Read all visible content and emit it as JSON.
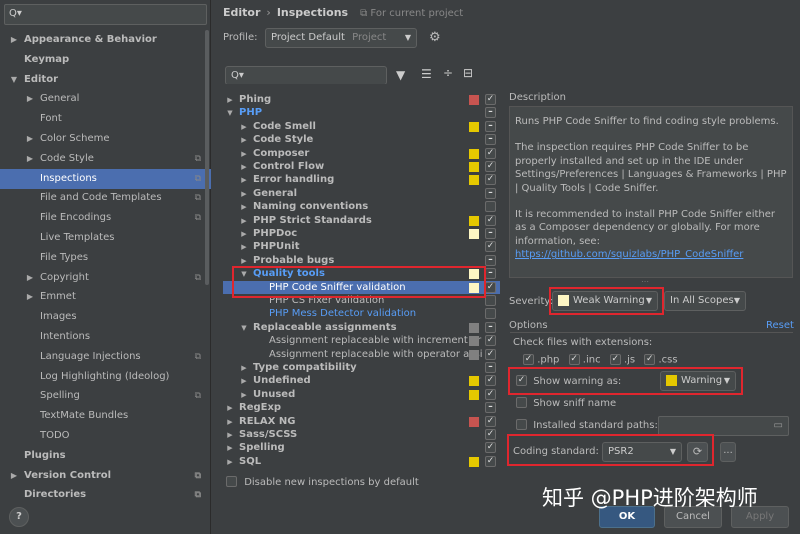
{
  "sidebar": {
    "search_placeholder": "Q▾",
    "items": [
      {
        "label": "Appearance & Behavior",
        "bold": true,
        "arrow": "▶",
        "indent": 0
      },
      {
        "label": "Keymap",
        "bold": true,
        "arrow": "",
        "indent": 0
      },
      {
        "label": "Editor",
        "bold": true,
        "arrow": "▼",
        "indent": 0
      },
      {
        "label": "General",
        "arrow": "▶",
        "indent": 1
      },
      {
        "label": "Font",
        "arrow": "",
        "indent": 1
      },
      {
        "label": "Color Scheme",
        "arrow": "▶",
        "indent": 1
      },
      {
        "label": "Code Style",
        "arrow": "▶",
        "indent": 1,
        "copy": true
      },
      {
        "label": "Inspections",
        "arrow": "",
        "indent": 1,
        "copy": true,
        "selected": true
      },
      {
        "label": "File and Code Templates",
        "arrow": "",
        "indent": 1,
        "copy": true
      },
      {
        "label": "File Encodings",
        "arrow": "",
        "indent": 1,
        "copy": true
      },
      {
        "label": "Live Templates",
        "arrow": "",
        "indent": 1
      },
      {
        "label": "File Types",
        "arrow": "",
        "indent": 1
      },
      {
        "label": "Copyright",
        "arrow": "▶",
        "indent": 1,
        "copy": true
      },
      {
        "label": "Emmet",
        "arrow": "▶",
        "indent": 1
      },
      {
        "label": "Images",
        "arrow": "",
        "indent": 1
      },
      {
        "label": "Intentions",
        "arrow": "",
        "indent": 1
      },
      {
        "label": "Language Injections",
        "arrow": "",
        "indent": 1,
        "copy": true
      },
      {
        "label": "Log Highlighting (Ideolog)",
        "arrow": "",
        "indent": 1
      },
      {
        "label": "Spelling",
        "arrow": "",
        "indent": 1,
        "copy": true
      },
      {
        "label": "TextMate Bundles",
        "arrow": "",
        "indent": 1
      },
      {
        "label": "TODO",
        "arrow": "",
        "indent": 1
      },
      {
        "label": "Plugins",
        "bold": true,
        "arrow": "",
        "indent": 0
      },
      {
        "label": "Version Control",
        "bold": true,
        "arrow": "▶",
        "indent": 0,
        "copy": true
      },
      {
        "label": "Directories",
        "bold": true,
        "arrow": "",
        "indent": 0,
        "copy": true
      }
    ]
  },
  "header": {
    "crumb1": "Editor",
    "sep": "›",
    "crumb2": "Inspections",
    "scope_note": "⧉ For current project"
  },
  "profile": {
    "label": "Profile:",
    "value": "Project Default",
    "value_hint": "Project"
  },
  "toolbar": {
    "search_placeholder": "Q▾"
  },
  "tree": [
    {
      "label": "Phing",
      "level": 0,
      "arrow": "▶",
      "bold": true,
      "sev": "#c75450",
      "cb": "✓"
    },
    {
      "label": "PHP",
      "level": 0,
      "arrow": "▼",
      "bold": true,
      "blue": true,
      "sev": "",
      "cb": "–"
    },
    {
      "label": "Code Smell",
      "level": 1,
      "arrow": "▶",
      "bold": true,
      "sev": "#e5c800",
      "cb": "–"
    },
    {
      "label": "Code Style",
      "level": 1,
      "arrow": "▶",
      "bold": true,
      "sev": "",
      "cb": "–"
    },
    {
      "label": "Composer",
      "level": 1,
      "arrow": "▶",
      "bold": true,
      "sev": "#e5c800",
      "cb": "✓"
    },
    {
      "label": "Control Flow",
      "level": 1,
      "arrow": "▶",
      "bold": true,
      "sev": "#e5c800",
      "cb": "✓"
    },
    {
      "label": "Error handling",
      "level": 1,
      "arrow": "▶",
      "bold": true,
      "sev": "#e5c800",
      "cb": "✓"
    },
    {
      "label": "General",
      "level": 1,
      "arrow": "▶",
      "bold": true,
      "sev": "",
      "cb": "–"
    },
    {
      "label": "Naming conventions",
      "level": 1,
      "arrow": "▶",
      "bold": true,
      "sev": "",
      "cb": ""
    },
    {
      "label": "PHP Strict Standards",
      "level": 1,
      "arrow": "▶",
      "bold": true,
      "sev": "#e5c800",
      "cb": "✓"
    },
    {
      "label": "PHPDoc",
      "level": 1,
      "arrow": "▶",
      "bold": true,
      "sev": "#fdf6c3",
      "cb": "–"
    },
    {
      "label": "PHPUnit",
      "level": 1,
      "arrow": "▶",
      "bold": true,
      "sev": "",
      "cb": "✓"
    },
    {
      "label": "Probable bugs",
      "level": 1,
      "arrow": "▶",
      "bold": true,
      "sev": "",
      "cb": "–"
    },
    {
      "label": "Quality tools",
      "level": 1,
      "arrow": "▼",
      "bold": true,
      "blue": true,
      "sev": "#fdf6c3",
      "cb": "–"
    },
    {
      "label": "PHP Code Sniffer validation",
      "level": 2,
      "arrow": "",
      "selected": true,
      "sev": "#fdf6c3",
      "cb": "✓"
    },
    {
      "label": "PHP CS Fixer validation",
      "level": 2,
      "arrow": "",
      "sev": "",
      "cb": ""
    },
    {
      "label": "PHP Mess Detector validation",
      "level": 2,
      "arrow": "",
      "blue": true,
      "sev": "",
      "cb": ""
    },
    {
      "label": "Replaceable assignments",
      "level": 1,
      "arrow": "▼",
      "bold": true,
      "sev": "#808080",
      "cb": "–"
    },
    {
      "label": "Assignment replaceable with increment or",
      "level": 2,
      "arrow": "",
      "sev": "#808080",
      "cb": "✓"
    },
    {
      "label": "Assignment replaceable with operator assi",
      "level": 2,
      "arrow": "",
      "sev": "#808080",
      "cb": "✓"
    },
    {
      "label": "Type compatibility",
      "level": 1,
      "arrow": "▶",
      "bold": true,
      "sev": "",
      "cb": "–"
    },
    {
      "label": "Undefined",
      "level": 1,
      "arrow": "▶",
      "bold": true,
      "sev": "#e5c800",
      "cb": "✓"
    },
    {
      "label": "Unused",
      "level": 1,
      "arrow": "▶",
      "bold": true,
      "sev": "#e5c800",
      "cb": "✓"
    },
    {
      "label": "RegExp",
      "level": 0,
      "arrow": "▶",
      "bold": true,
      "sev": "",
      "cb": "–"
    },
    {
      "label": "RELAX NG",
      "level": 0,
      "arrow": "▶",
      "bold": true,
      "sev": "#c75450",
      "cb": "✓"
    },
    {
      "label": "Sass/SCSS",
      "level": 0,
      "arrow": "▶",
      "bold": true,
      "sev": "",
      "cb": "✓"
    },
    {
      "label": "Spelling",
      "level": 0,
      "arrow": "▶",
      "bold": true,
      "sev": "",
      "cb": "✓"
    },
    {
      "label": "SQL",
      "level": 0,
      "arrow": "▶",
      "bold": true,
      "sev": "#e5c800",
      "cb": "✓"
    }
  ],
  "disable_new": "Disable new inspections by default",
  "description": {
    "label": "Description",
    "p1": "Runs PHP Code Sniffer to find coding style problems.",
    "p2": "The inspection requires PHP Code Sniffer to be properly installed and set up in the IDE under Settings/Preferences | Languages & Frameworks | PHP | Quality Tools | Code Sniffer.",
    "p3": "It is recommended to install PHP Code Sniffer either as a Composer dependency or globally. For more information, see: ",
    "link": "https://github.com/squizlabs/PHP_CodeSniffer"
  },
  "severity": {
    "label": "Severity:",
    "value": "Weak Warning",
    "swatch_color": "#fdf6c3",
    "scope": "In All Scopes"
  },
  "options": {
    "label": "Options",
    "reset": "Reset",
    "check_files": "Check files with extensions:",
    "ext1": ".php",
    "ext2": ".inc",
    "ext3": ".js",
    "ext4": ".css",
    "show_warning_as": "Show warning as:",
    "warning_value": "Warning",
    "warning_color": "#e5c800",
    "show_sniff": "Show sniff name",
    "installed_paths": "Installed standard paths:",
    "coding_standard": "Coding standard:",
    "coding_value": "PSR2",
    "ellipsis": "..."
  },
  "buttons": {
    "ok": "OK",
    "cancel": "Cancel",
    "apply": "Apply",
    "help": "?"
  },
  "watermark": "知乎 @PHP进阶架构师",
  "colors": {
    "accent": "#4b6eaf",
    "highlight": "#e0262e"
  }
}
